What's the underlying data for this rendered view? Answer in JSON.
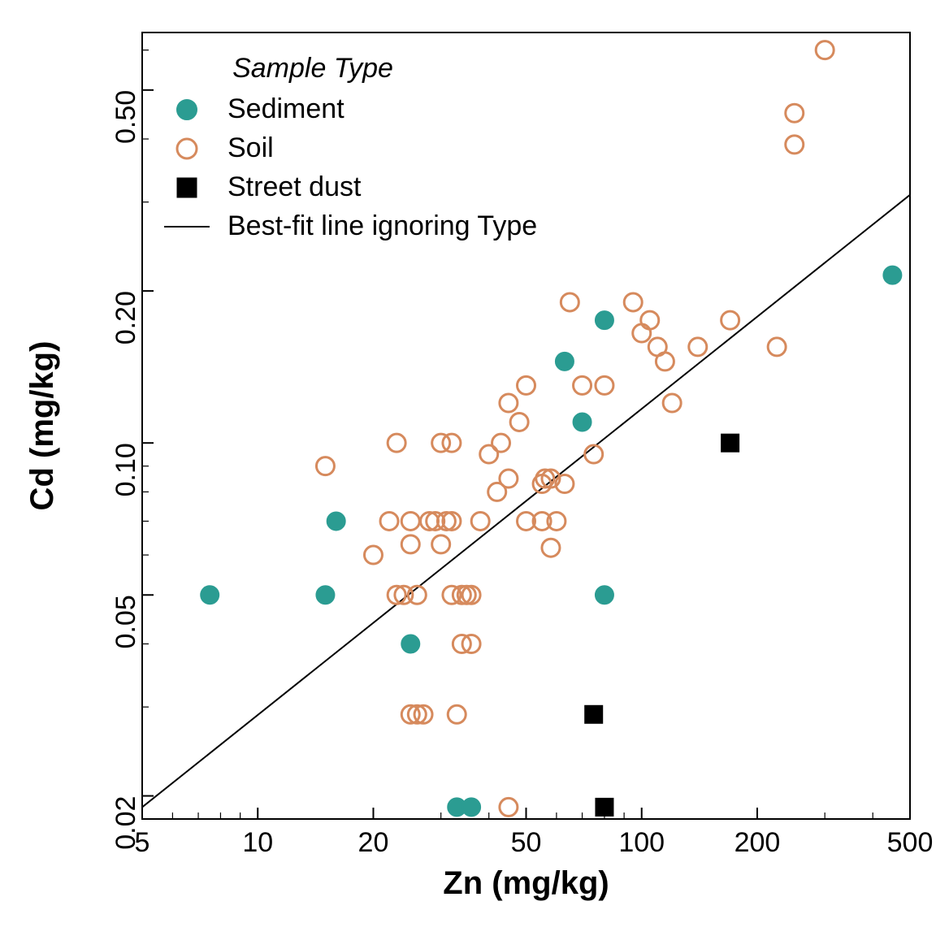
{
  "chart_data": {
    "type": "scatter",
    "title": "",
    "xlabel": "Zn (mg/kg)",
    "ylabel": "Cd (mg/kg)",
    "xscale": "log",
    "yscale": "log",
    "xlim": [
      5,
      500
    ],
    "ylim": [
      0.018,
      0.65
    ],
    "x_ticks": [
      5,
      10,
      20,
      50,
      100,
      200,
      500
    ],
    "y_ticks": [
      0.02,
      0.05,
      0.1,
      0.2,
      0.5
    ],
    "legend": {
      "title": "Sample Type",
      "position": "top-left",
      "entries": [
        {
          "name": "Sediment",
          "marker": "filled-circle",
          "color": "#2b9c92"
        },
        {
          "name": "Soil",
          "marker": "open-circle",
          "color": "#d68a5d"
        },
        {
          "name": "Street dust",
          "marker": "filled-square",
          "color": "#000000"
        },
        {
          "name": "Best-fit line ignoring Type",
          "marker": "line",
          "color": "#000000"
        }
      ]
    },
    "fit_line": {
      "x": [
        5,
        500
      ],
      "y": [
        0.019,
        0.31
      ]
    },
    "series": [
      {
        "name": "Sediment",
        "marker": "filled-circle",
        "color": "#2b9c92",
        "points": [
          {
            "x": 7.5,
            "y": 0.05
          },
          {
            "x": 15,
            "y": 0.05
          },
          {
            "x": 16,
            "y": 0.07
          },
          {
            "x": 25,
            "y": 0.04
          },
          {
            "x": 33,
            "y": 0.019
          },
          {
            "x": 36,
            "y": 0.019
          },
          {
            "x": 63,
            "y": 0.145
          },
          {
            "x": 70,
            "y": 0.11
          },
          {
            "x": 80,
            "y": 0.175
          },
          {
            "x": 80,
            "y": 0.05
          },
          {
            "x": 450,
            "y": 0.215
          }
        ]
      },
      {
        "name": "Soil",
        "marker": "open-circle",
        "color": "#d68a5d",
        "points": [
          {
            "x": 15,
            "y": 0.09
          },
          {
            "x": 20,
            "y": 0.06
          },
          {
            "x": 22,
            "y": 0.07
          },
          {
            "x": 23,
            "y": 0.05
          },
          {
            "x": 23,
            "y": 0.1
          },
          {
            "x": 24,
            "y": 0.05
          },
          {
            "x": 25,
            "y": 0.029
          },
          {
            "x": 25,
            "y": 0.063
          },
          {
            "x": 25,
            "y": 0.07
          },
          {
            "x": 26,
            "y": 0.029
          },
          {
            "x": 26,
            "y": 0.05
          },
          {
            "x": 27,
            "y": 0.029
          },
          {
            "x": 28,
            "y": 0.07
          },
          {
            "x": 29,
            "y": 0.07
          },
          {
            "x": 30,
            "y": 0.063
          },
          {
            "x": 30,
            "y": 0.1
          },
          {
            "x": 31,
            "y": 0.07
          },
          {
            "x": 32,
            "y": 0.05
          },
          {
            "x": 32,
            "y": 0.07
          },
          {
            "x": 32,
            "y": 0.1
          },
          {
            "x": 33,
            "y": 0.029
          },
          {
            "x": 34,
            "y": 0.04
          },
          {
            "x": 34,
            "y": 0.05
          },
          {
            "x": 35,
            "y": 0.05
          },
          {
            "x": 36,
            "y": 0.04
          },
          {
            "x": 36,
            "y": 0.05
          },
          {
            "x": 38,
            "y": 0.07
          },
          {
            "x": 40,
            "y": 0.095
          },
          {
            "x": 42,
            "y": 0.08
          },
          {
            "x": 43,
            "y": 0.1
          },
          {
            "x": 45,
            "y": 0.019
          },
          {
            "x": 45,
            "y": 0.085
          },
          {
            "x": 45,
            "y": 0.12
          },
          {
            "x": 48,
            "y": 0.11
          },
          {
            "x": 50,
            "y": 0.07
          },
          {
            "x": 50,
            "y": 0.13
          },
          {
            "x": 55,
            "y": 0.07
          },
          {
            "x": 55,
            "y": 0.083
          },
          {
            "x": 56,
            "y": 0.085
          },
          {
            "x": 58,
            "y": 0.085
          },
          {
            "x": 58,
            "y": 0.062
          },
          {
            "x": 60,
            "y": 0.07
          },
          {
            "x": 63,
            "y": 0.083
          },
          {
            "x": 65,
            "y": 0.19
          },
          {
            "x": 70,
            "y": 0.13
          },
          {
            "x": 75,
            "y": 0.095
          },
          {
            "x": 80,
            "y": 0.13
          },
          {
            "x": 95,
            "y": 0.19
          },
          {
            "x": 100,
            "y": 0.165
          },
          {
            "x": 105,
            "y": 0.175
          },
          {
            "x": 110,
            "y": 0.155
          },
          {
            "x": 115,
            "y": 0.145
          },
          {
            "x": 120,
            "y": 0.12
          },
          {
            "x": 140,
            "y": 0.155
          },
          {
            "x": 170,
            "y": 0.175
          },
          {
            "x": 225,
            "y": 0.155
          },
          {
            "x": 250,
            "y": 0.39
          },
          {
            "x": 250,
            "y": 0.45
          },
          {
            "x": 300,
            "y": 0.6
          }
        ]
      },
      {
        "name": "Street dust",
        "marker": "filled-square",
        "color": "#000000",
        "points": [
          {
            "x": 75,
            "y": 0.029
          },
          {
            "x": 80,
            "y": 0.019
          },
          {
            "x": 170,
            "y": 0.1
          }
        ]
      }
    ]
  }
}
